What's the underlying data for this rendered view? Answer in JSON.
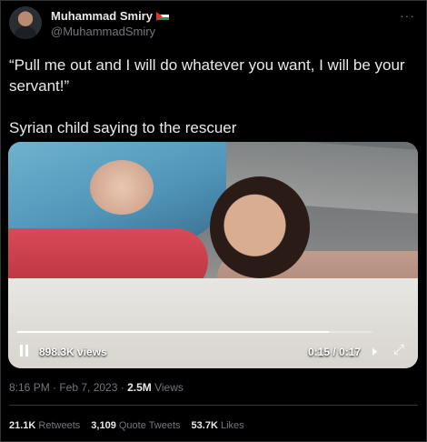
{
  "tweet": {
    "author_name": "Muhammad Smiry",
    "handle": "@MuhammadSmiry",
    "more_label": "···",
    "text_quote": "“Pull me out and I will do whatever you want, I will be your servant!”",
    "text_caption": "Syrian child saying to the rescuer",
    "timestamp": "8:16 PM · Feb 7, 2023 · ",
    "views_count": "2.5M",
    "views_label": " Views"
  },
  "video": {
    "views_overlay": "898.3K views",
    "time": "0:15 / 0:17",
    "progress": 0.88,
    "volume_icon": "🕨",
    "fullscreen_icon": "⤢"
  },
  "stats": {
    "retweets_count": "21.1K",
    "retweets_label": "Retweets",
    "quotes_count": "3,109",
    "quotes_label": "Quote Tweets",
    "likes_count": "53.7K",
    "likes_label": "Likes"
  }
}
